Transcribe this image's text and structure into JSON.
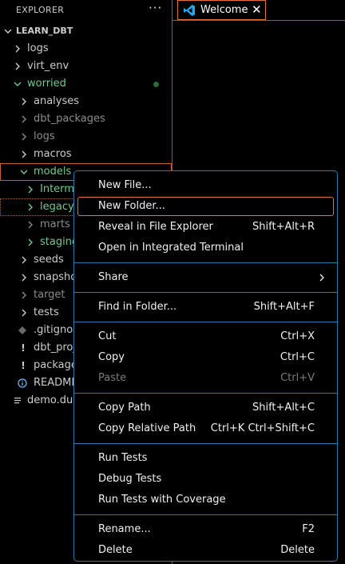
{
  "explorer": {
    "title": "EXPLORER",
    "more": "···"
  },
  "tab": {
    "label": "Welcome",
    "close": "✕"
  },
  "tree": {
    "root": "LEARN_DBT",
    "items": [
      {
        "label": "logs"
      },
      {
        "label": "virt_env"
      },
      {
        "label": "worried"
      },
      {
        "label": "analyses"
      },
      {
        "label": "dbt_packages"
      },
      {
        "label": "logs"
      },
      {
        "label": "macros"
      },
      {
        "label": "models"
      },
      {
        "label": "Interme"
      },
      {
        "label": "legacy"
      },
      {
        "label": "marts"
      },
      {
        "label": "staging"
      },
      {
        "label": "seeds"
      },
      {
        "label": "snapshot"
      },
      {
        "label": "target"
      },
      {
        "label": "tests"
      },
      {
        "label": ".gitignor"
      },
      {
        "label": "dbt_proje"
      },
      {
        "label": "package."
      },
      {
        "label": "READMEI"
      },
      {
        "label": "demo.duc"
      }
    ]
  },
  "menu": {
    "new_file": "New File...",
    "new_folder": "New Folder...",
    "reveal": "Reveal in File Explorer",
    "reveal_key": "Shift+Alt+R",
    "open_terminal": "Open in Integrated Terminal",
    "share": "Share",
    "find_in_folder": "Find in Folder...",
    "find_key": "Shift+Alt+F",
    "cut": "Cut",
    "cut_key": "Ctrl+X",
    "copy": "Copy",
    "copy_key": "Ctrl+C",
    "paste": "Paste",
    "paste_key": "Ctrl+V",
    "copy_path": "Copy Path",
    "copy_path_key": "Shift+Alt+C",
    "copy_rel_path": "Copy Relative Path",
    "copy_rel_path_key": "Ctrl+K Ctrl+Shift+C",
    "run_tests": "Run Tests",
    "debug_tests": "Debug Tests",
    "run_cov": "Run Tests with Coverage",
    "rename": "Rename...",
    "rename_key": "F2",
    "delete": "Delete",
    "delete_key": "Delete"
  },
  "colors": {
    "accent_border": "#2b79a7",
    "focus_border": "#e0713b",
    "git_green": "#73c991"
  }
}
